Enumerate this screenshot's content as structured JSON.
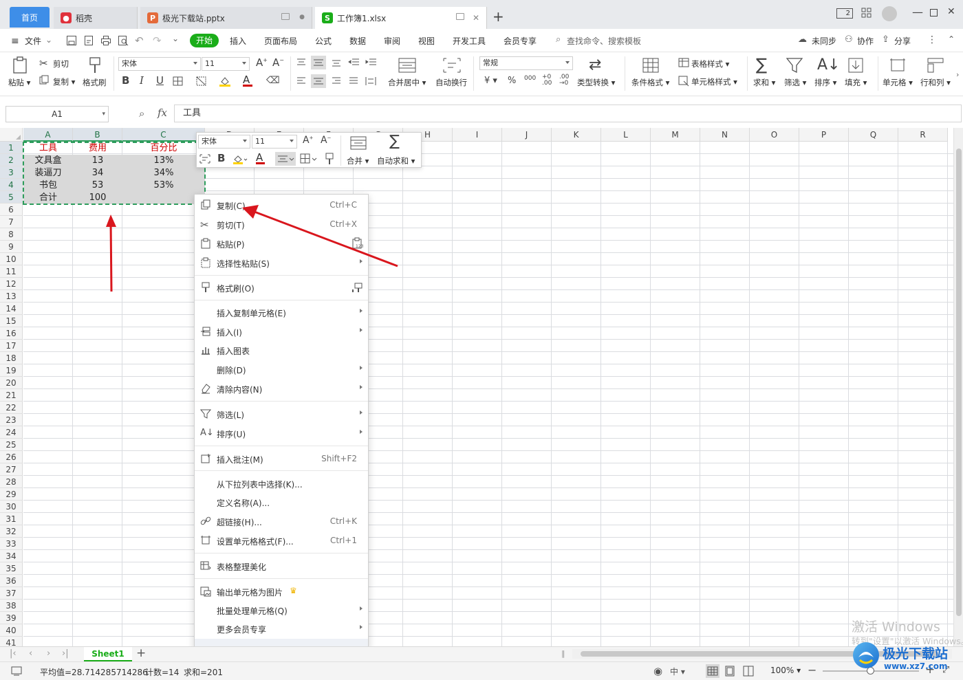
{
  "titlebar": {
    "home_tab": "首页",
    "tabs": [
      {
        "label": "稻壳",
        "icon": "daoke-icon",
        "color": "#e0323c"
      },
      {
        "label": "极光下载站.pptx",
        "icon": "pptx-icon",
        "color": "#e46a3a"
      },
      {
        "label": "工作簿1.xlsx",
        "icon": "xlsx-icon",
        "color": "#1aad19"
      }
    ],
    "new_tab": "+",
    "page_badge": "2"
  },
  "menu": {
    "file": "文件",
    "items": [
      "开始",
      "插入",
      "页面布局",
      "公式",
      "数据",
      "审阅",
      "视图",
      "开发工具",
      "会员专享"
    ],
    "search": "查找命令、搜索模板",
    "unsynced": "未同步",
    "collab": "协作",
    "share": "分享"
  },
  "ribbon": {
    "paste": "粘贴",
    "cut": "剪切",
    "copy": "复制",
    "format_painter": "格式刷",
    "font_name": "宋体",
    "font_size": "11",
    "merge_center": "合并居中",
    "wrap_text": "自动换行",
    "number_format": "常规",
    "type_convert": "类型转换",
    "conditional_format": "条件格式",
    "table_style": "表格样式",
    "cell_style": "单元格样式",
    "sum": "求和",
    "filter": "筛选",
    "sort": "排序",
    "fill": "填充",
    "cell": "单元格",
    "row_col": "行和列",
    "currency": "¥",
    "percent": "%"
  },
  "formula_bar": {
    "cell_ref": "A1",
    "fx": "fx",
    "content": "工具"
  },
  "grid": {
    "columns": [
      "A",
      "B",
      "C",
      "D",
      "E",
      "F",
      "G",
      "H",
      "I",
      "J",
      "K",
      "L",
      "M",
      "N",
      "O",
      "P",
      "Q",
      "R"
    ],
    "rows": [
      "1",
      "2",
      "3",
      "4",
      "5",
      "6",
      "7",
      "8",
      "9",
      "10",
      "11",
      "12",
      "13",
      "14",
      "15",
      "16",
      "17",
      "18",
      "19",
      "20",
      "21",
      "22",
      "23",
      "24",
      "25",
      "26",
      "27",
      "28",
      "29",
      "30",
      "31",
      "32",
      "33",
      "34",
      "35",
      "36",
      "37",
      "38",
      "39",
      "40",
      "41"
    ],
    "cells": [
      [
        "工具",
        "费用",
        "百分比"
      ],
      [
        "文具盒",
        "13",
        "13%"
      ],
      [
        "装逼刀",
        "34",
        "34%"
      ],
      [
        "书包",
        "53",
        "53%"
      ],
      [
        "合计",
        "100",
        ""
      ]
    ]
  },
  "mini_toolbar": {
    "font_name": "宋体",
    "font_size": "11",
    "merge": "合并",
    "autosum": "自动求和"
  },
  "context_menu": [
    {
      "label": "复制(C)",
      "shortcut": "Ctrl+C",
      "icon": "copy-icon"
    },
    {
      "label": "剪切(T)",
      "shortcut": "Ctrl+X",
      "icon": "scissors-icon"
    },
    {
      "label": "粘贴(P)",
      "shortcut": "",
      "icon": "paste-icon"
    },
    {
      "label": "选择性粘贴(S)",
      "shortcut": "",
      "icon": "paste-special-icon"
    },
    {
      "label": "格式刷(O)",
      "shortcut": "",
      "icon": "format-painter-icon"
    },
    {
      "label": "插入复制单元格(E)",
      "shortcut": "",
      "icon": ""
    },
    {
      "label": "插入(I)",
      "shortcut": "",
      "icon": "insert-icon"
    },
    {
      "label": "插入图表",
      "shortcut": "",
      "icon": "chart-icon"
    },
    {
      "label": "删除(D)",
      "shortcut": "",
      "icon": ""
    },
    {
      "label": "清除内容(N)",
      "shortcut": "",
      "icon": "eraser-icon"
    },
    {
      "label": "筛选(L)",
      "shortcut": "",
      "icon": "filter-icon"
    },
    {
      "label": "排序(U)",
      "shortcut": "",
      "icon": "sort-icon"
    },
    {
      "label": "插入批注(M)",
      "shortcut": "Shift+F2",
      "icon": "comment-icon"
    },
    {
      "label": "从下拉列表中选择(K)...",
      "shortcut": "",
      "icon": ""
    },
    {
      "label": "定义名称(A)...",
      "shortcut": "",
      "icon": ""
    },
    {
      "label": "超链接(H)...",
      "shortcut": "Ctrl+K",
      "icon": "link-icon"
    },
    {
      "label": "设置单元格格式(F)...",
      "shortcut": "Ctrl+1",
      "icon": "cell-format-icon"
    },
    {
      "label": "表格整理美化",
      "shortcut": "",
      "icon": "beautify-icon"
    },
    {
      "label": "输出单元格为图片",
      "shortcut": "",
      "icon": "image-export-icon"
    },
    {
      "label": "批量处理单元格(Q)",
      "shortcut": "",
      "icon": ""
    },
    {
      "label": "更多会员专享",
      "shortcut": "",
      "icon": ""
    }
  ],
  "sheet_tabs": {
    "active": "Sheet1",
    "add": "+"
  },
  "status_bar": {
    "average": "平均值=28.714285714286",
    "count": "计数=14",
    "sum": "求和=201",
    "zoom": "100%"
  },
  "watermark": {
    "line1": "激活 Windows",
    "line2": "转到\"设置\"以激活 Windows。",
    "site_name": "极光下载站",
    "site_url": "www.xz7.com"
  },
  "colors": {
    "accent_green": "#1aad19",
    "home_blue": "#3e8ee8",
    "header_red": "#d00000",
    "selection_border": "#2d9d5c",
    "arrow_red": "#d9161d"
  }
}
